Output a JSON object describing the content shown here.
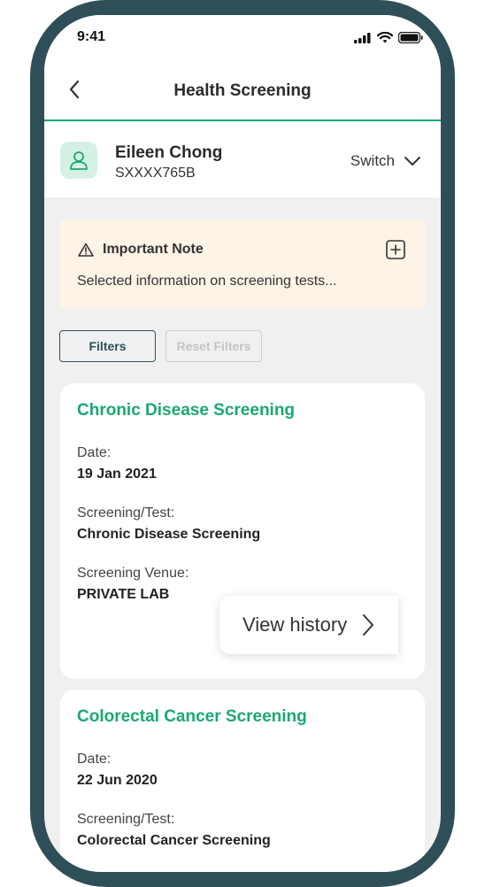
{
  "status_bar": {
    "time": "9:41",
    "icons": [
      "signal-icon",
      "wifi-icon",
      "battery-icon"
    ]
  },
  "nav": {
    "title": "Health Screening",
    "back_icon": "chevron-left-icon"
  },
  "profile": {
    "name": "Eileen Chong",
    "id": "SXXXX765B",
    "switch_label": "Switch",
    "avatar_icon": "user-icon"
  },
  "note": {
    "title": "Important Note",
    "text": "Selected information on screening tests...",
    "icon": "warning-icon",
    "expand_icon": "plus-square-icon"
  },
  "filters": {
    "filters_label": "Filters",
    "reset_label": "Reset Filters"
  },
  "cards": [
    {
      "title": "Chronic Disease Screening",
      "date_label": "Date:",
      "date_value": "19 Jan 2021",
      "test_label": "Screening/Test:",
      "test_value": "Chronic Disease Screening",
      "venue_label": "Screening Venue:",
      "venue_value": "PRIVATE LAB"
    },
    {
      "title": "Colorectal Cancer Screening",
      "date_label": "Date:",
      "date_value": "22 Jun 2020",
      "test_label": "Screening/Test:",
      "test_value": "Colorectal Cancer Screening"
    }
  ],
  "view_history": {
    "label": "View history"
  },
  "colors": {
    "frame": "#2f4f58",
    "accent": "#1aa872",
    "note_bg": "#fdf3e7"
  }
}
